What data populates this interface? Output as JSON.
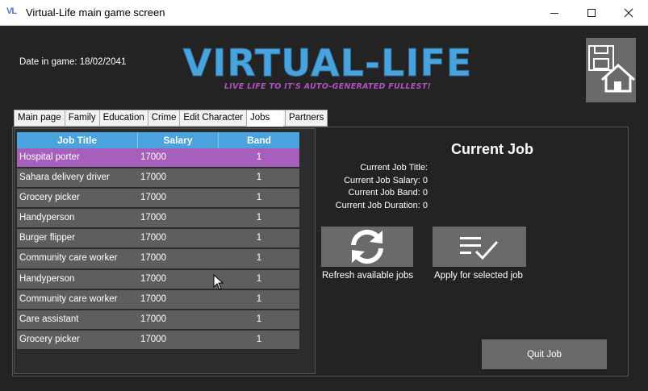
{
  "window": {
    "title": "Virtual-Life main game screen",
    "icon_text": "VL",
    "minimize_icon": "minimize-icon",
    "maximize_icon": "maximize-icon",
    "close_icon": "close-icon"
  },
  "header": {
    "date_label": "Date in game: 18/02/2041",
    "logo_title": "VIRTUAL-LIFE",
    "logo_tagline": "LIVE LIFE TO IT'S AUTO-GENERATED FULLEST!",
    "save_home_icon": "save-home-icon"
  },
  "tabs": [
    {
      "label": "Main page",
      "active": false
    },
    {
      "label": "Family",
      "active": false
    },
    {
      "label": "Education",
      "active": false
    },
    {
      "label": "Crime",
      "active": false
    },
    {
      "label": "Edit Character",
      "active": false
    },
    {
      "label": "Jobs",
      "active": true
    },
    {
      "label": "Partners",
      "active": false
    }
  ],
  "jobs_table": {
    "columns": [
      "Job Title",
      "Salary",
      "Band"
    ],
    "selected_row": 0,
    "rows": [
      {
        "title": "Hospital porter",
        "salary": "17000",
        "band": "1"
      },
      {
        "title": "Sahara delivery driver",
        "salary": "17000",
        "band": "1"
      },
      {
        "title": "Grocery picker",
        "salary": "17000",
        "band": "1"
      },
      {
        "title": "Handyperson",
        "salary": "17000",
        "band": "1"
      },
      {
        "title": "Burger flipper",
        "salary": "17000",
        "band": "1"
      },
      {
        "title": "Community care worker",
        "salary": "17000",
        "band": "1"
      },
      {
        "title": "Handyperson",
        "salary": "17000",
        "band": "1"
      },
      {
        "title": "Community care worker",
        "salary": "17000",
        "band": "1"
      },
      {
        "title": "Care assistant",
        "salary": "17000",
        "band": "1"
      },
      {
        "title": "Grocery picker",
        "salary": "17000",
        "band": "1"
      }
    ]
  },
  "current_job": {
    "heading": "Current Job",
    "title_line": "Current Job Title:",
    "salary_line": "Current Job Salary: 0",
    "band_line": "Current Job Band: 0",
    "duration_line": "Current Job Duration: 0"
  },
  "actions": {
    "refresh_label": "Refresh available jobs",
    "refresh_icon": "refresh-icon",
    "apply_label": "Apply for selected job",
    "apply_icon": "checklist-icon",
    "quit_label": "Quit Job"
  },
  "colors": {
    "accent_blue": "#4aa3dc",
    "selection_purple": "#a65fbc",
    "background": "#232323",
    "button_gray": "#6a6a6a"
  }
}
